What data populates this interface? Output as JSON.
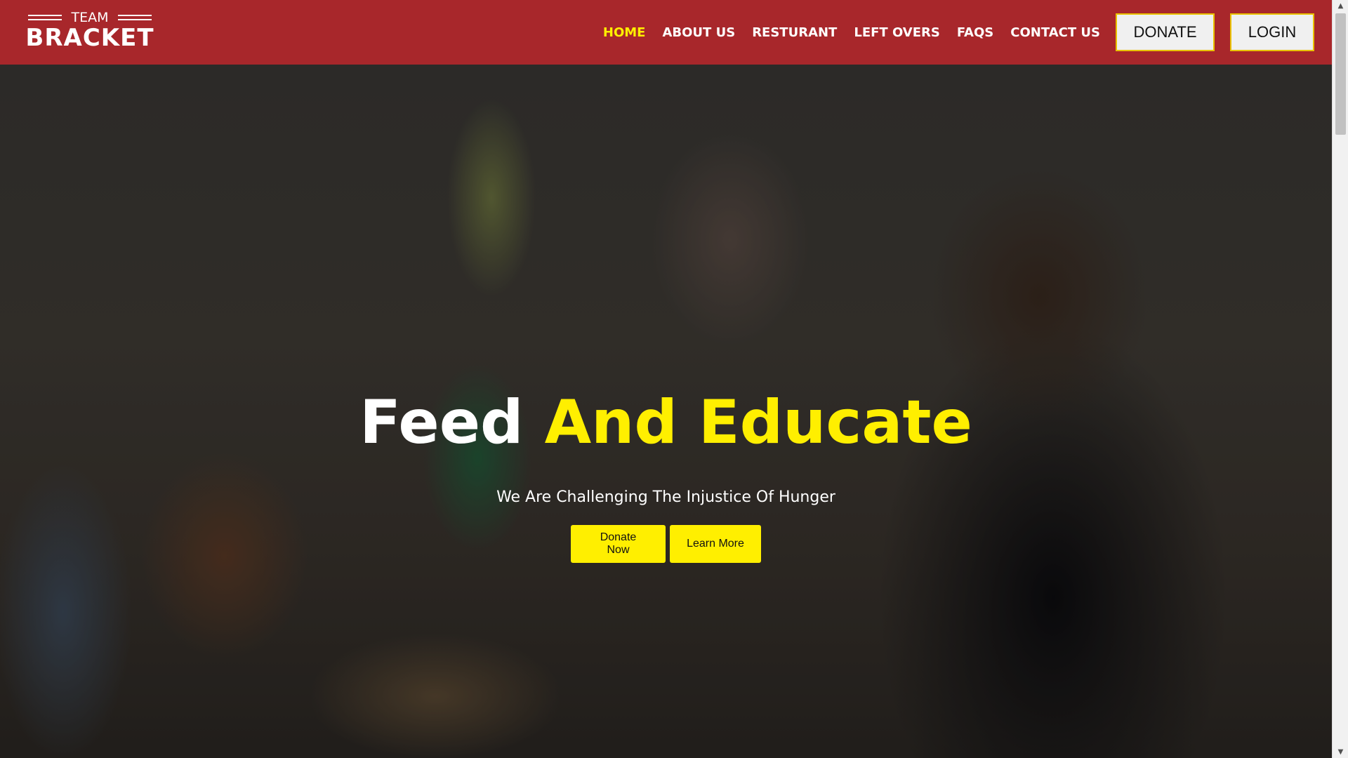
{
  "logo": {
    "top_text": "TEAM",
    "main_text": "BRACKET"
  },
  "nav": {
    "links": [
      {
        "label": "HOME",
        "active": true
      },
      {
        "label": "ABOUT US",
        "active": false
      },
      {
        "label": "RESTURANT",
        "active": false
      },
      {
        "label": "LEFT OVERS",
        "active": false
      },
      {
        "label": "FAQS",
        "active": false
      },
      {
        "label": "CONTACT US",
        "active": false
      }
    ],
    "donate_label": "DONATE",
    "login_label": "LOGIN"
  },
  "hero": {
    "title_plain": "Feed",
    "title_accent": "And Educate",
    "subtitle": "We Are Challenging The Injustice Of Hunger",
    "donate_now_label": "Donate Now",
    "learn_more_label": "Learn More"
  },
  "colors": {
    "navbar_bg": "#a8272b",
    "accent_yellow": "#ffef00",
    "button_border": "#e9c200"
  },
  "icons": {
    "scroll_up": "triangle-up-icon",
    "scroll_down": "triangle-down-icon"
  }
}
